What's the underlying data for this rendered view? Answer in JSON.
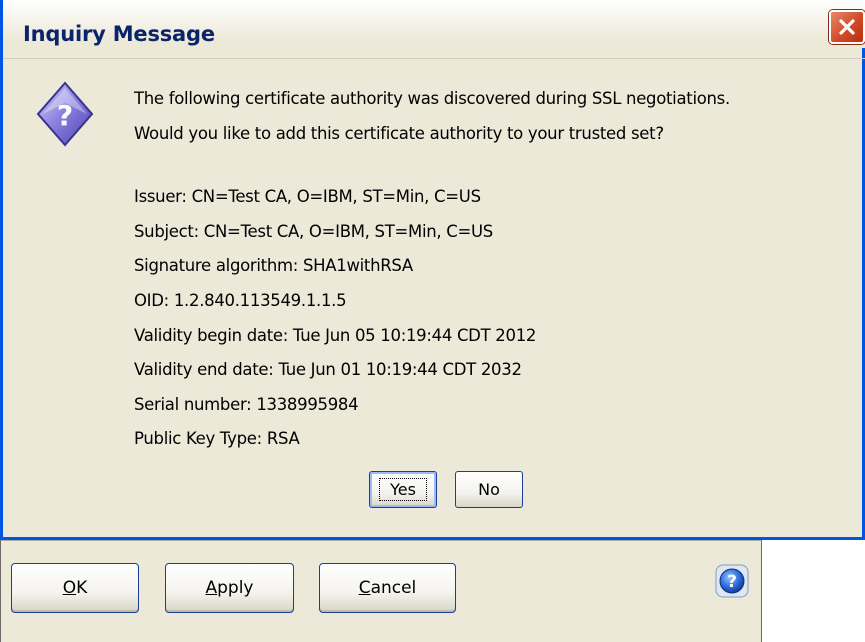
{
  "dialog": {
    "title": "Inquiry Message",
    "message_line1": "The following certificate authority was discovered during SSL negotiations.",
    "message_line2": "Would you like to add this certificate authority to your trusted set?",
    "details": [
      "Issuer: CN=Test CA, O=IBM, ST=Min, C=US",
      "Subject: CN=Test CA, O=IBM, ST=Min, C=US",
      "Signature algorithm: SHA1withRSA",
      "OID: 1.2.840.113549.1.1.5",
      "Validity begin date: Tue Jun 05 10:19:44 CDT 2012",
      "Validity end date: Tue Jun 01 10:19:44 CDT 2032",
      "Serial number: 1338995984",
      "Public Key Type: RSA"
    ],
    "yes_label": "Yes",
    "no_label": "No",
    "icon": "question-icon"
  },
  "parent": {
    "ok_mnemonic": "O",
    "ok_rest": "K",
    "apply_mnemonic": "A",
    "apply_rest": "pply",
    "cancel_mnemonic": "C",
    "cancel_rest": "ancel",
    "help_icon": "help-icon"
  },
  "colors": {
    "dialog_border": "#0054e3",
    "window_face": "#ece9d8",
    "title_text": "#0a246a",
    "close_red": "#d14a28"
  }
}
